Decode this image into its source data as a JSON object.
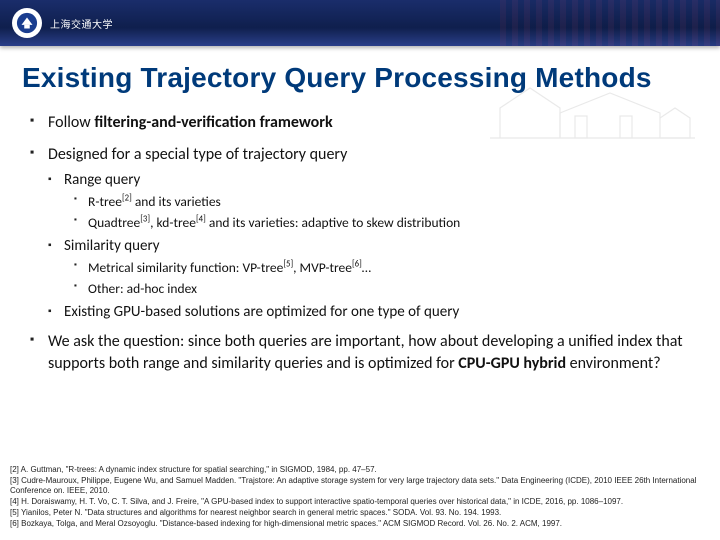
{
  "header": {
    "university_name": "上海交通大学"
  },
  "title": "Existing Trajectory Query Processing Methods",
  "bullets": {
    "b1_pre": "Follow ",
    "b1_bold": "filtering-and-verification framework",
    "b2": "Designed for a special type of trajectory query",
    "b2a": "Range query",
    "b2a_i": "R-tree[2] and its varieties",
    "b2a_ii": "Quadtree[3], kd-tree[4] and its varieties: adaptive to skew distribution",
    "b2b": "Similarity query",
    "b2b_i": "Metrical similarity function: VP-tree[5], MVP-tree[6]…",
    "b2b_ii": "Other: ad-hoc index",
    "b2c": "Existing GPU-based solutions are optimized for one type of query",
    "b3_pre": "We ask the question: since both queries are important, how about developing a unified index that supports both range and similarity queries and is optimized for ",
    "b3_bold": "CPU-GPU hybrid",
    "b3_post": " environment?"
  },
  "refs": {
    "r2": "[2] A. Guttman, \"R-trees: A dynamic index structure for spatial searching,\" in SIGMOD, 1984, pp. 47–57.",
    "r3": "[3] Cudre-Mauroux, Philippe, Eugene Wu, and Samuel Madden. \"Trajstore: An adaptive storage system for very large trajectory data sets.\" Data Engineering (ICDE), 2010 IEEE 26th International Conference on. IEEE, 2010.",
    "r4": "[4] H. Doraiswamy, H. T. Vo, C. T. Silva, and J. Freire, \"A GPU-based index to support interactive spatio-temporal queries over historical data,\" in ICDE, 2016, pp. 1086–1097.",
    "r5": "[5] Yianilos, Peter N. \"Data structures and algorithms for nearest neighbor search in general metric spaces.\" SODA. Vol. 93. No. 194. 1993.",
    "r6": "[6] Bozkaya, Tolga, and Meral Ozsoyoglu. \"Distance-based indexing for high-dimensional metric spaces.\" ACM SIGMOD Record. Vol. 26. No. 2. ACM, 1997."
  }
}
